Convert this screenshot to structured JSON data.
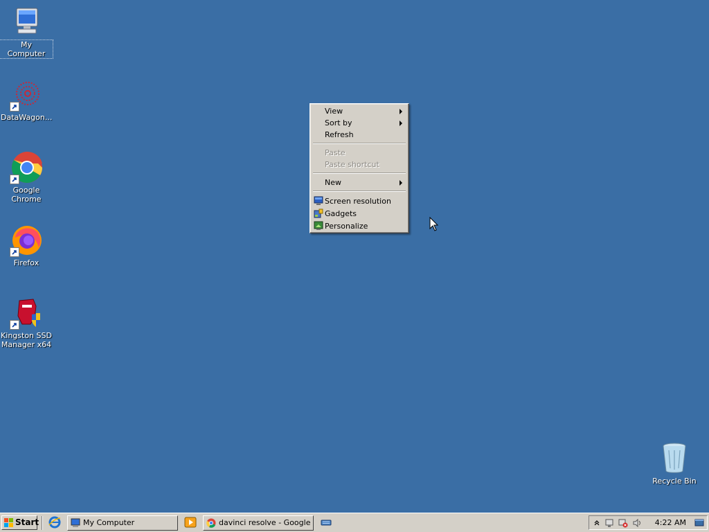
{
  "desktop": {
    "icons": [
      {
        "label": "My Computer",
        "icon": "my-computer-icon"
      },
      {
        "label": "DataWagon...",
        "icon": "datawagon-icon"
      },
      {
        "label": "Google Chrome",
        "icon": "chrome-icon"
      },
      {
        "label": "Firefox",
        "icon": "firefox-icon"
      },
      {
        "label_line1": "Kingston SSD",
        "label_line2": "Manager x64",
        "icon": "kingston-icon"
      },
      {
        "label": "Recycle Bin",
        "icon": "recycle-bin-icon"
      }
    ],
    "background_color": "#3a6ea5"
  },
  "context_menu": {
    "items": [
      {
        "label": "View",
        "submenu": true
      },
      {
        "label": "Sort by",
        "submenu": true
      },
      {
        "label": "Refresh"
      },
      {
        "label": "Paste",
        "disabled": true
      },
      {
        "label": "Paste shortcut",
        "disabled": true
      },
      {
        "label": "New",
        "submenu": true
      },
      {
        "label": "Screen resolution",
        "icon": "monitor-icon"
      },
      {
        "label": "Gadgets",
        "icon": "gadgets-icon"
      },
      {
        "label": "Personalize",
        "icon": "personalize-icon"
      }
    ]
  },
  "taskbar": {
    "start_label": "Start",
    "tasks": [
      {
        "label": "My Computer",
        "icon": "my-computer-icon"
      },
      {
        "label": "davinci resolve - Google ...",
        "icon": "chrome-icon"
      }
    ],
    "clock": "4:22 AM"
  }
}
